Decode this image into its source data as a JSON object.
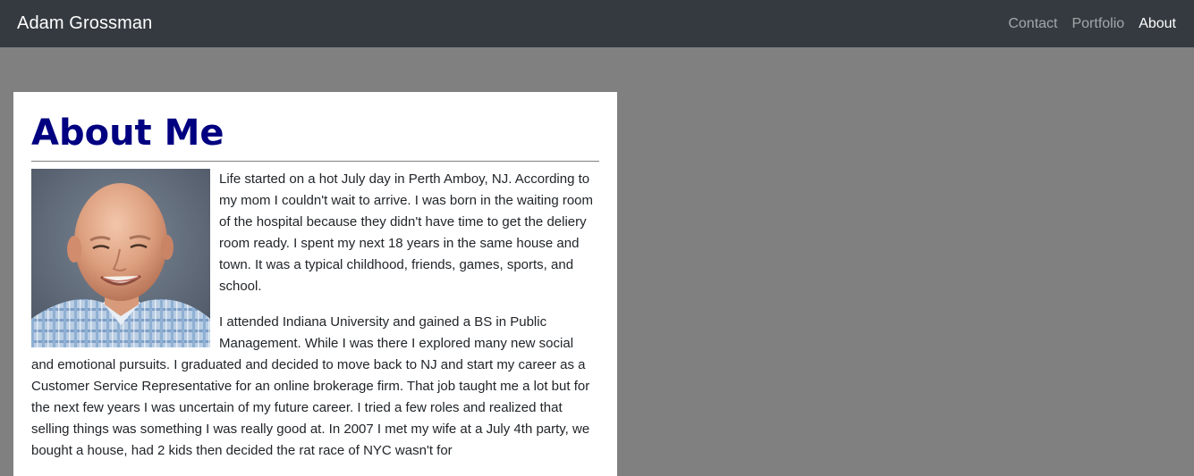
{
  "nav": {
    "brand": "Adam Grossman",
    "links": [
      {
        "label": "Contact",
        "active": false
      },
      {
        "label": "Portfolio",
        "active": false
      },
      {
        "label": "About",
        "active": true
      }
    ]
  },
  "about": {
    "title": "About Me",
    "photo_alt": "Adam Grossman portrait",
    "paragraphs": [
      "Life started on a hot July day in Perth Amboy, NJ. According to my mom I couldn't wait to arrive. I was born in the waiting room of the hospital because they didn't have time to get the deliery room ready. I spent my next 18 years in the same house and town. It was a typical childhood, friends, games, sports, and school.",
      "I attended Indiana University and gained a BS in Public Management. While I was there I explored many new social and emotional pursuits. I graduated and decided to move back to NJ and start my career as a Customer Service Representative for an online brokerage firm. That job taught me a lot but for the next few years I was uncertain of my future career. I tried a few roles and realized that selling things was something I was really good at. In 2007 I met my wife at a July 4th party, we bought a house, had 2 kids then decided the rat race of NYC wasn't for"
    ]
  },
  "colors": {
    "navbar_bg": "#343a40",
    "page_bg": "#808080",
    "title_color": "#000080"
  }
}
